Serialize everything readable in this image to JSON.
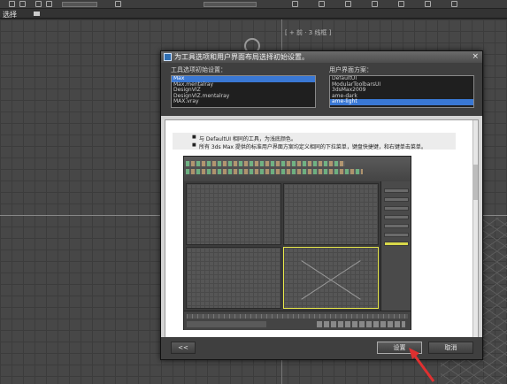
{
  "app": {
    "menu_label": "选择",
    "viewport_label": "[ + 前 · 3 线框 ]"
  },
  "dialog": {
    "title": "为工具选项和用户界面布局选择初始设置。",
    "close": "×",
    "tools_caption": "工具选项初始设置：",
    "tools_items": [
      "Max",
      "Max.mentalray",
      "DesignVIZ",
      "DesignVIZ.mentalray",
      "MAX.vray"
    ],
    "tools_selected": 0,
    "ui_caption": "用户界面方案：",
    "ui_items": [
      "DefaultUI",
      "ModularToolbarsUI",
      "3dsMax2009",
      "ame-dark",
      "ame-light"
    ],
    "ui_selected": 4,
    "bullets": [
      "与 DefaultUI 相同的工具，为浅底颜色。",
      "所有 3ds Max 提供的标准用户界面方案均定义相同的下拉菜单，键盘快捷键，和右键单击菜单。"
    ],
    "back_button": "<<",
    "set_button": "设置",
    "cancel_button": "取消"
  },
  "colors": {
    "selection": "#3a78d4",
    "arrow": "#e03030"
  }
}
